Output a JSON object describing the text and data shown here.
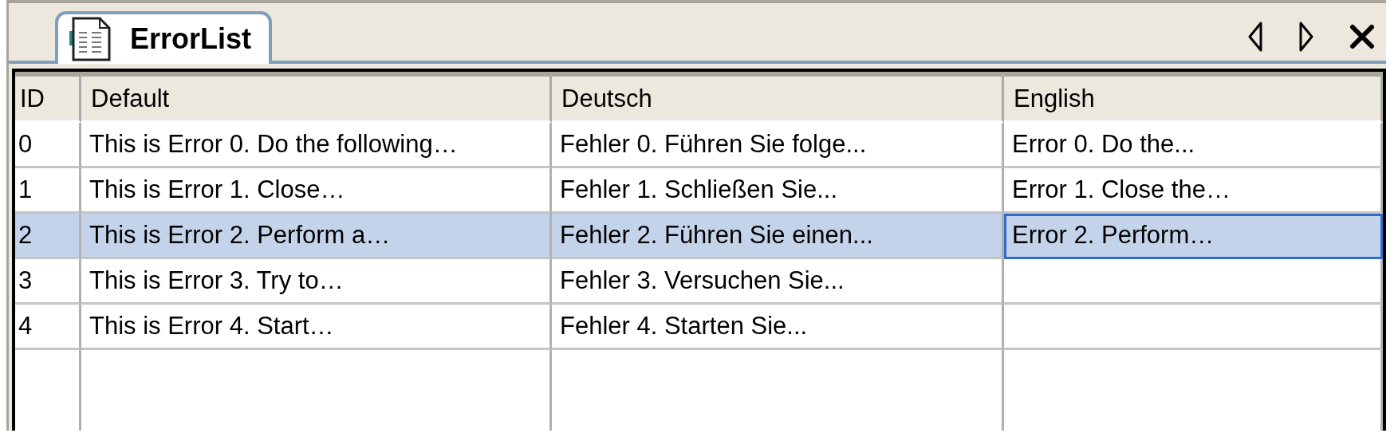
{
  "tab": {
    "label": "ErrorList",
    "selected": true
  },
  "table": {
    "columns": [
      "ID",
      "Default",
      "Deutsch",
      "English"
    ],
    "rows": [
      {
        "selected": false,
        "cells": [
          {
            "text": "0",
            "focused": false
          },
          {
            "text": "This is Error 0. Do the following…",
            "focused": false
          },
          {
            "text": "Fehler 0. Führen Sie folge...",
            "focused": false
          },
          {
            "text": "Error 0. Do the...",
            "focused": false
          }
        ]
      },
      {
        "selected": false,
        "cells": [
          {
            "text": "1",
            "focused": false
          },
          {
            "text": "This is Error 1. Close…",
            "focused": false
          },
          {
            "text": "Fehler 1. Schließen Sie...",
            "focused": false
          },
          {
            "text": "Error 1. Close the…",
            "focused": false
          }
        ]
      },
      {
        "selected": true,
        "cells": [
          {
            "text": "2",
            "focused": false
          },
          {
            "text": "This is Error 2. Perform a…",
            "focused": false
          },
          {
            "text": "Fehler 2. Führen Sie einen...",
            "focused": false
          },
          {
            "text": "Error 2. Perform…",
            "focused": true
          }
        ]
      },
      {
        "selected": false,
        "cells": [
          {
            "text": "3",
            "focused": false
          },
          {
            "text": "This is Error 3. Try to…",
            "focused": false
          },
          {
            "text": "Fehler 3. Versuchen Sie...",
            "focused": false
          },
          {
            "text": "",
            "focused": false
          }
        ]
      },
      {
        "selected": false,
        "cells": [
          {
            "text": "4",
            "focused": false
          },
          {
            "text": "This is Error 4. Start…",
            "focused": false
          },
          {
            "text": "Fehler 4. Starten Sie...",
            "focused": false
          },
          {
            "text": "",
            "focused": false
          }
        ]
      }
    ]
  }
}
